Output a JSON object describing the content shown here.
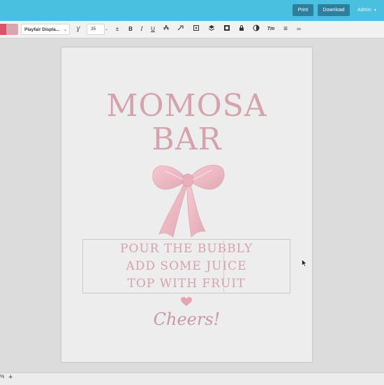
{
  "topbar": {
    "print_label": "Print",
    "download_label": "Download",
    "admin_label": "Admin",
    "color": "#49c0e0"
  },
  "toolbar": {
    "swatches": [
      "#d9536a",
      "#d8a6af"
    ],
    "font_name": "Playfair Displa...",
    "font_size": "35",
    "tools": [
      "text-style-icon",
      "align-icon",
      "bold-icon",
      "italic-icon",
      "underline-icon",
      "strikethrough-icon",
      "link-icon",
      "duplicate-icon",
      "layers-icon",
      "frame-icon",
      "lock-icon",
      "opacity-icon",
      "text-case-icon",
      "line-spacing-icon",
      "distribute-icon"
    ],
    "tool_glyphs": {
      "text_style": "Ɣ",
      "align": "±",
      "bold": "B",
      "italic": "I",
      "underline": "U",
      "strikethrough": "§",
      "text_case": "Tт",
      "line_spacing": "≡",
      "distribute": "═"
    }
  },
  "document": {
    "title_line1": "MOMOSA",
    "title_line2": "BAR",
    "instructions": [
      "POUR THE BUBBLY",
      "ADD SOME JUICE",
      "TOP WITH FRUIT"
    ],
    "closing": "Cheers!",
    "accent_color": "#d4a3ac"
  },
  "bottombar": {
    "zoom_label": "%",
    "add_label": "+"
  }
}
